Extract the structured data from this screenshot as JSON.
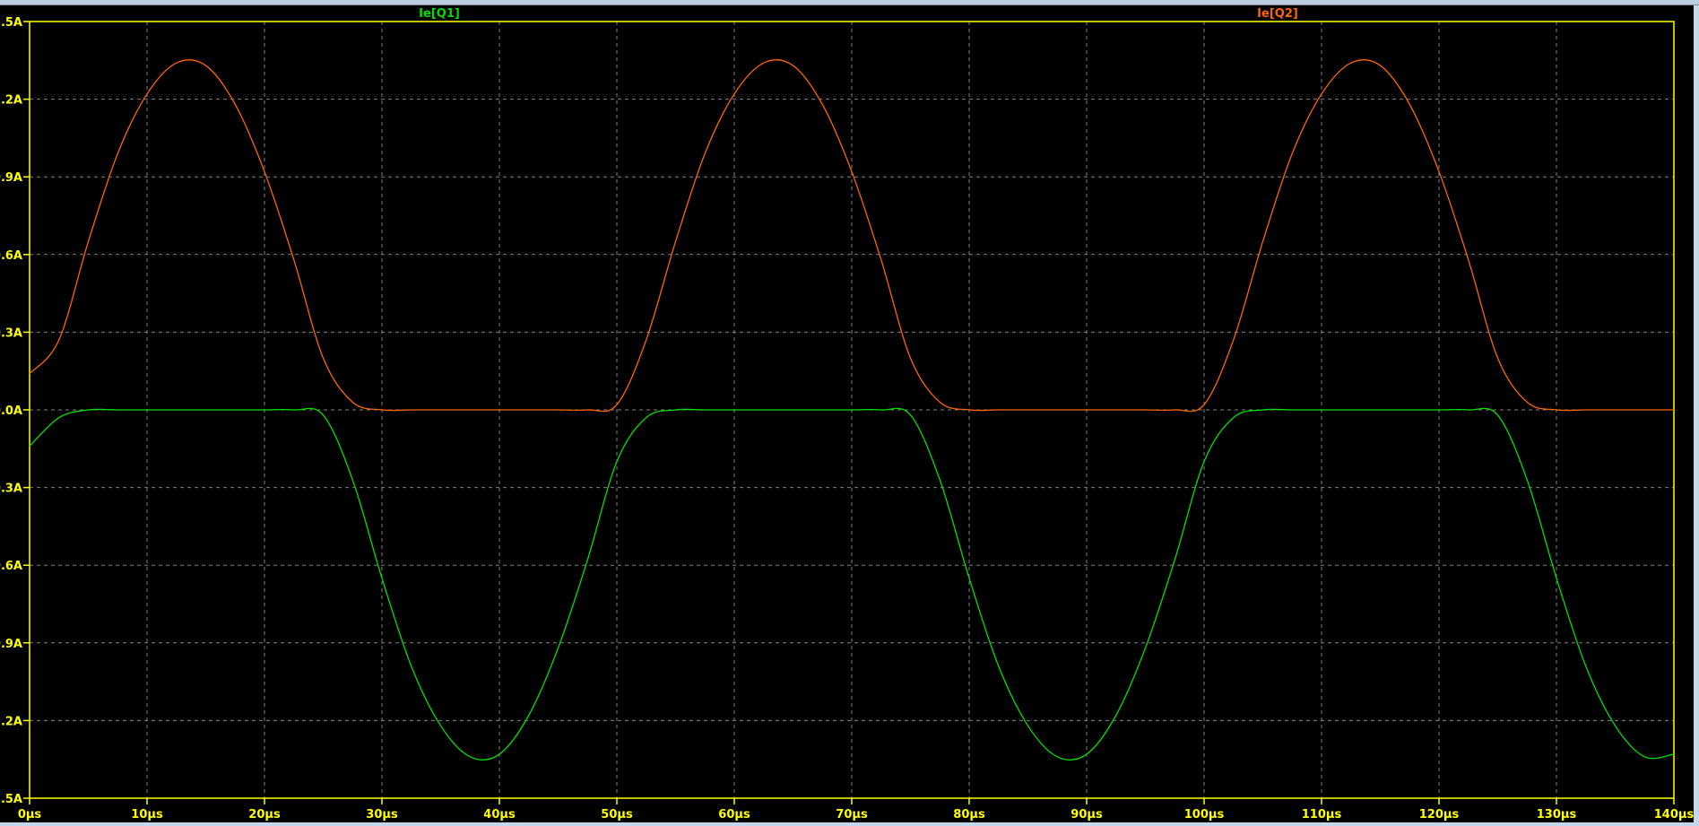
{
  "chart_data": {
    "type": "line",
    "title": "",
    "xlabel": "",
    "ylabel": "",
    "xlim": [
      0,
      140
    ],
    "ylim": [
      -1.5,
      1.5
    ],
    "grid": true,
    "x_ticks": [
      0,
      10,
      20,
      30,
      40,
      50,
      60,
      70,
      80,
      90,
      100,
      110,
      120,
      130,
      140
    ],
    "x_tick_labels": [
      "0µs",
      "10µs",
      "20µs",
      "30µs",
      "40µs",
      "50µs",
      "60µs",
      "70µs",
      "80µs",
      "90µs",
      "100µs",
      "110µs",
      "120µs",
      "130µs",
      "140µs"
    ],
    "y_ticks": [
      1.5,
      1.2,
      0.9,
      0.6,
      0.3,
      0.0,
      -0.3,
      -0.6,
      -0.9,
      -1.2,
      -1.5
    ],
    "y_tick_labels": [
      "1.5A",
      "1.2A",
      "0.9A",
      "0.6A",
      "0.3A",
      "0.0A",
      "-0.3A",
      "-0.6A",
      "-0.9A",
      "-1.2A",
      "-1.5A"
    ],
    "x": [
      0,
      2.5,
      5,
      7.5,
      10,
      12.5,
      15,
      17.5,
      20,
      22.5,
      25,
      27.5,
      30,
      32.5,
      35,
      37.5,
      40,
      42.5,
      45,
      47.5,
      50,
      52.5,
      55,
      57.5,
      60,
      62.5,
      65,
      67.5,
      70,
      72.5,
      75,
      77.5,
      80,
      82.5,
      85,
      87.5,
      90,
      92.5,
      95,
      97.5,
      100,
      102.5,
      105,
      107.5,
      110,
      112.5,
      115,
      117.5,
      120,
      122.5,
      125,
      127.5,
      130,
      132.5,
      135,
      137.5,
      140
    ],
    "series": [
      {
        "name": "Ie[Q1]",
        "color": "#00e000",
        "values": [
          -0.14,
          -0.03,
          0,
          0,
          0,
          0,
          0,
          0,
          0,
          0,
          -0.02,
          -0.27,
          -0.65,
          -0.99,
          -1.22,
          -1.34,
          -1.33,
          -1.18,
          -0.92,
          -0.58,
          -0.2,
          -0.03,
          0,
          0,
          0,
          0,
          0,
          0,
          0,
          0,
          -0.02,
          -0.27,
          -0.65,
          -0.99,
          -1.22,
          -1.34,
          -1.33,
          -1.18,
          -0.92,
          -0.58,
          -0.2,
          -0.03,
          0,
          0,
          0,
          0,
          0,
          0,
          0,
          0,
          -0.02,
          -0.27,
          -0.65,
          -0.99,
          -1.22,
          -1.34,
          -1.33
        ]
      },
      {
        "name": "Ie[Q2]",
        "color": "#ff6600",
        "values": [
          0.14,
          0.27,
          0.65,
          0.99,
          1.22,
          1.34,
          1.33,
          1.18,
          0.92,
          0.58,
          0.2,
          0.03,
          0,
          0,
          0,
          0,
          0,
          0,
          0,
          0,
          0.02,
          0.27,
          0.65,
          0.99,
          1.22,
          1.34,
          1.33,
          1.18,
          0.92,
          0.58,
          0.2,
          0.03,
          0,
          0,
          0,
          0,
          0,
          0,
          0,
          0,
          0.02,
          0.27,
          0.65,
          0.99,
          1.22,
          1.34,
          1.33,
          1.18,
          0.92,
          0.58,
          0.2,
          0.03,
          0,
          0,
          0,
          0,
          0
        ]
      }
    ],
    "axis_color": "#ffff00",
    "grid_color": "#808080",
    "background": "#000000"
  }
}
